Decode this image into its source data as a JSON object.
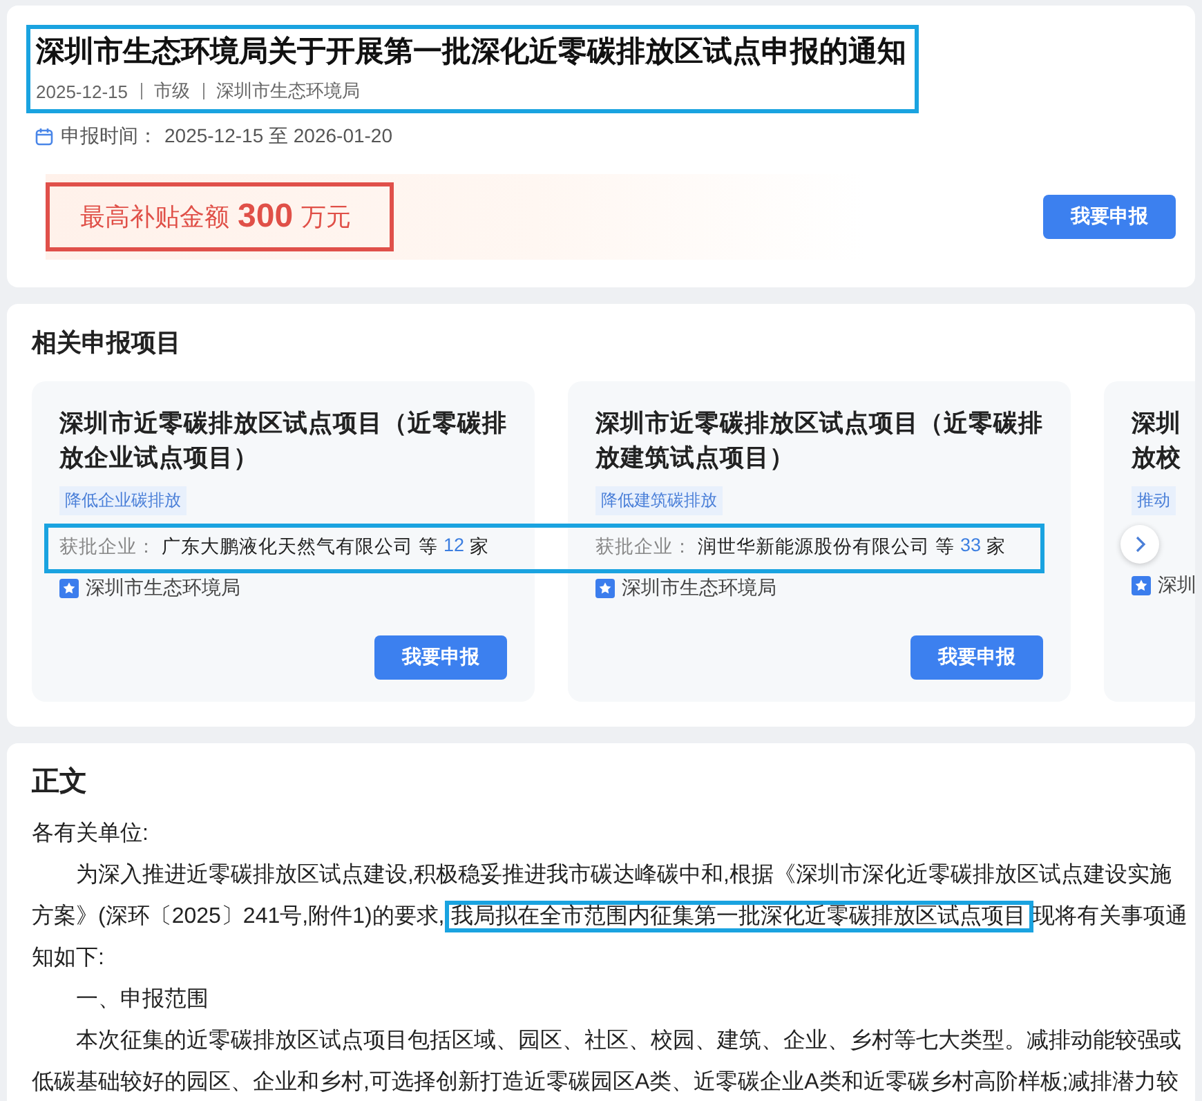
{
  "notice": {
    "title": "深圳市生态环境局关于开展第一批深化近零碳排放区试点申报的通知",
    "meta": [
      "2025-12-15",
      "市级",
      "深圳市生态环境局"
    ],
    "period_label": "申报时间：",
    "period": "2025-12-15 至 2026-01-20",
    "subsidy": {
      "label": "最高补贴金额",
      "amount": "300",
      "unit": "万元"
    },
    "apply_button": "我要申报"
  },
  "related": {
    "heading": "相关申报项目",
    "projects": [
      {
        "title_lines": [
          "深圳市近零碳排放区试点项目（近零碳排",
          "放企业试点项目）"
        ],
        "tag": "降低企业碳排放",
        "approved_label": "获批企业：",
        "approved_company": "广东大鹏液化天然气有限公司",
        "approved_more": "等",
        "approved_count": "12",
        "approved_unit": "家",
        "issuer": "深圳市生态环境局",
        "button": "我要申报"
      },
      {
        "title_lines": [
          "深圳市近零碳排放区试点项目（近零碳排",
          "放建筑试点项目）"
        ],
        "tag": "降低建筑碳排放",
        "approved_label": "获批企业：",
        "approved_company": "润世华新能源股份有限公司",
        "approved_more": "等",
        "approved_count": "33",
        "approved_unit": "家",
        "issuer": "深圳市生态环境局",
        "button": "我要申报"
      },
      {
        "title_lines": [
          "深圳",
          "放校"
        ],
        "tag": "推动",
        "issuer": "深圳"
      }
    ]
  },
  "body": {
    "heading": "正文",
    "paragraphs": [
      {
        "kind": "salutation",
        "parts": [
          {
            "text": "各有关单位:",
            "highlighted": false
          }
        ]
      },
      {
        "kind": "paragraph",
        "parts": [
          {
            "text": "为深入推进近零碳排放区试点建设,积极稳妥推进我市碳达峰碳中和,根据《深圳市深化近零碳排放区试点建设实施方案》(深环〔2025〕241号,附件1)的要求,",
            "highlighted": false
          },
          {
            "text": "我局拟在全市范围内征集第一批深化近零碳排放区试点项目",
            "highlighted": true
          },
          {
            "text": "现将有关事项通知如下:",
            "highlighted": false
          }
        ]
      },
      {
        "kind": "paragraph",
        "parts": [
          {
            "text": "一、申报范围",
            "highlighted": false
          }
        ]
      },
      {
        "kind": "paragraph",
        "parts": [
          {
            "text": "本次征集的近零碳排放区试点项目包括区域、园区、社区、校园、建筑、企业、乡村等七大类型。减排动能较强或低碳基础较好的园区、企业和乡村,可选择创新打造近零碳园区A类、近零碳企业A类和近零碳乡村高阶样板;减排潜力较",
            "highlighted": false
          }
        ]
      }
    ]
  }
}
